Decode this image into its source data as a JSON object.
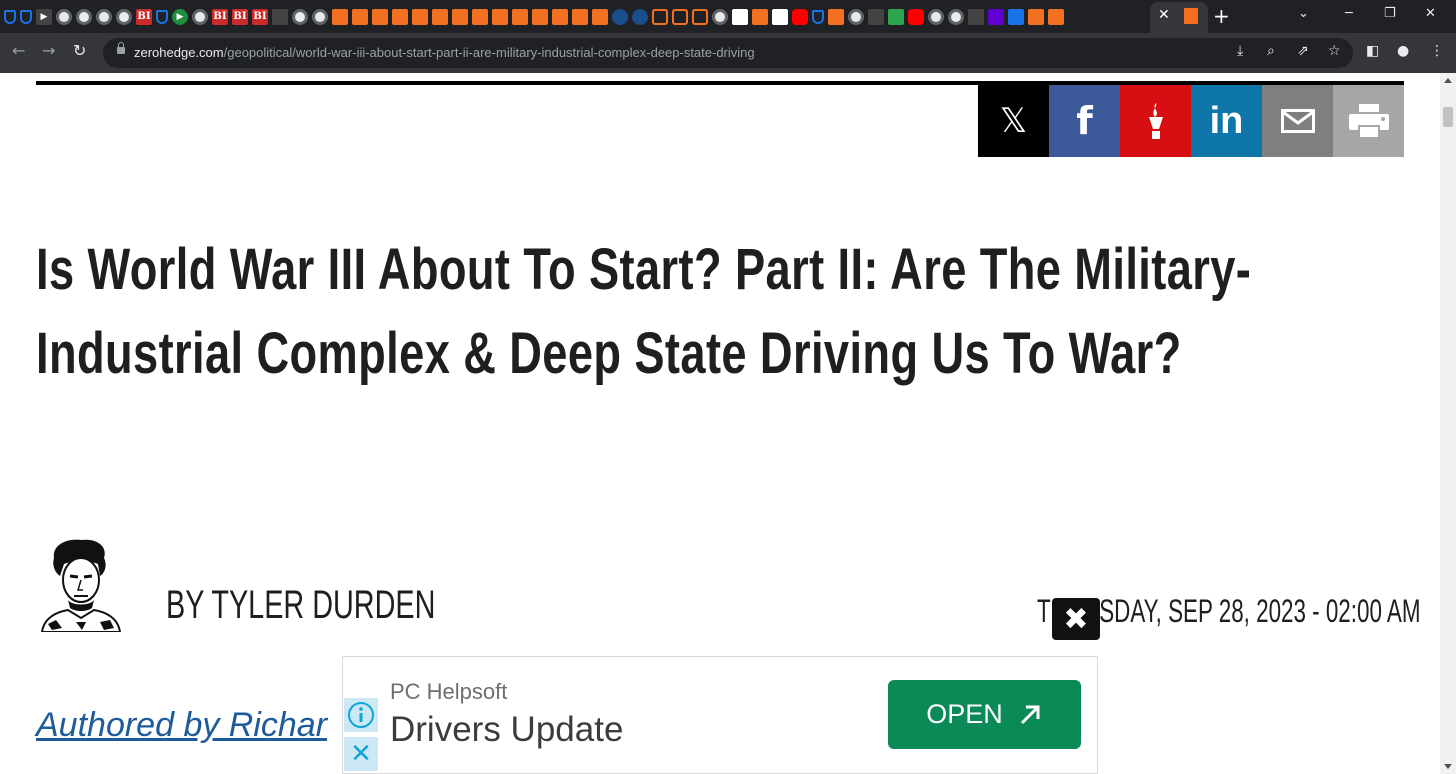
{
  "browser": {
    "url_host": "zerohedge.com",
    "url_path": "/geopolitical/world-war-iii-about-start-part-ii-are-military-industrial-complex-deep-state-driving",
    "tab_close": "✕",
    "new_tab": "+"
  },
  "share": {
    "x_label": "𝕏",
    "facebook_label": "f",
    "linkedin_label": "in"
  },
  "article": {
    "title": "Is World War III About To Start? Part II: Are The Military-Industrial Complex & Deep State Driving Us To War?",
    "byline": "BY TYLER DURDEN",
    "date": "THURSDAY, SEP 28, 2023 - 02:00 AM",
    "authored": "Authored by Richar"
  },
  "ad": {
    "brand": "PC Helpsoft",
    "headline": "Drivers Update",
    "cta": "OPEN",
    "close_glyph": "✖",
    "x_glyph": "✕"
  }
}
